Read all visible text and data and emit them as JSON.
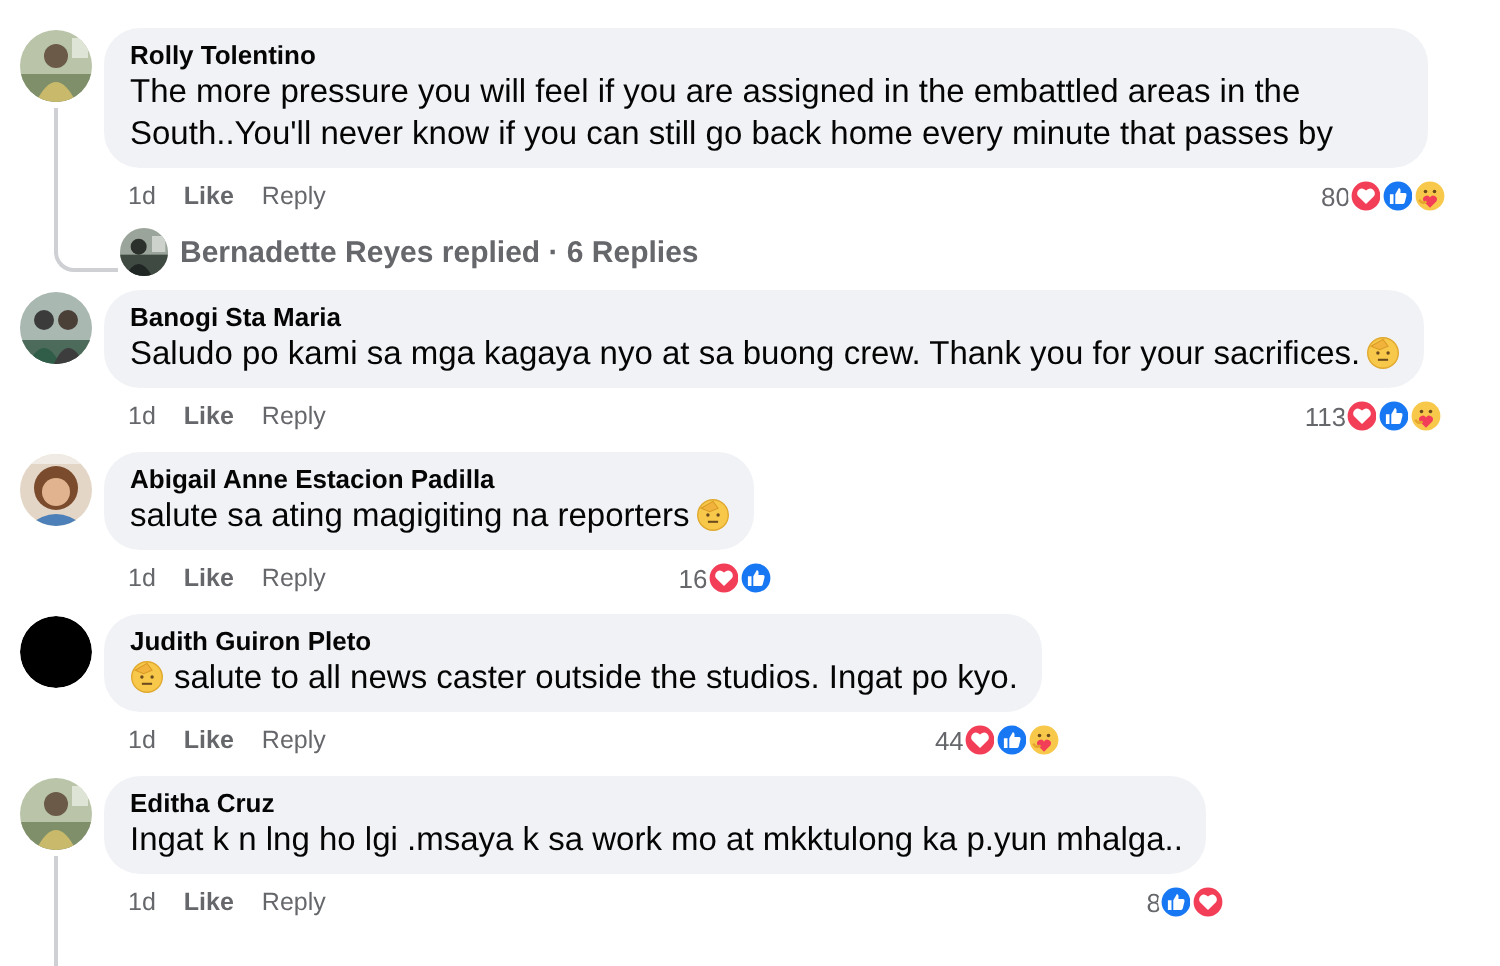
{
  "comments": [
    {
      "author": "Rolly Tolentino",
      "avatar": {
        "kind": "picture"
      },
      "body": [
        {
          "kind": "text",
          "text": "The more pressure you will feel if you are assigned in the embattled areas in the South..You'll never know if you can still go back home every minute that passes by"
        }
      ],
      "time": "1d",
      "like": "Like",
      "reply": "Reply",
      "reaction_count": "80",
      "reactions": [
        {
          "kind": "love"
        },
        {
          "kind": "like"
        },
        {
          "kind": "care"
        }
      ],
      "replies": {
        "text": "Bernadette Reyes replied · 6 Replies"
      },
      "thread_continues": false
    },
    {
      "author": "Banogi Sta Maria",
      "avatar": {
        "kind": "picture"
      },
      "body": [
        {
          "kind": "text",
          "text": "Saludo po kami sa mga kagaya nyo at sa buong crew. Thank you for your sacrifices."
        },
        {
          "kind": "salute_emoji"
        }
      ],
      "time": "1d",
      "like": "Like",
      "reply": "Reply",
      "reaction_count": "113",
      "reactions": [
        {
          "kind": "love"
        },
        {
          "kind": "like"
        },
        {
          "kind": "care"
        }
      ],
      "thread_continues": false
    },
    {
      "author": "Abigail Anne Estacion Padilla",
      "avatar": {
        "kind": "picture"
      },
      "body": [
        {
          "kind": "text",
          "text": "salute sa ating magigiting na reporters"
        },
        {
          "kind": "salute_emoji"
        }
      ],
      "time": "1d",
      "like": "Like",
      "reply": "Reply",
      "reaction_count": "16",
      "reactions": [
        {
          "kind": "love"
        },
        {
          "kind": "like"
        }
      ],
      "thread_continues": false
    },
    {
      "author": "Judith Guiron Pleto",
      "avatar": {
        "kind": "blank"
      },
      "body": [
        {
          "kind": "salute_emoji"
        },
        {
          "kind": "text",
          "text": "salute to all news caster outside the studios. Ingat po kyo."
        }
      ],
      "time": "1d",
      "like": "Like",
      "reply": "Reply",
      "reaction_count": "44",
      "reactions": [
        {
          "kind": "love"
        },
        {
          "kind": "like"
        },
        {
          "kind": "care"
        }
      ],
      "thread_continues": false
    },
    {
      "author": "Editha Cruz",
      "avatar": {
        "kind": "picture"
      },
      "body": [
        {
          "kind": "text",
          "text": "Ingat k n lng ho lgi .msaya k sa work mo at mkktulong ka p.yun mhalga.."
        }
      ],
      "time": "1d",
      "like": "Like",
      "reply": "Reply",
      "reaction_count": "8",
      "reactions": [
        {
          "kind": "like"
        },
        {
          "kind": "love"
        }
      ],
      "thread_continues": true
    }
  ]
}
